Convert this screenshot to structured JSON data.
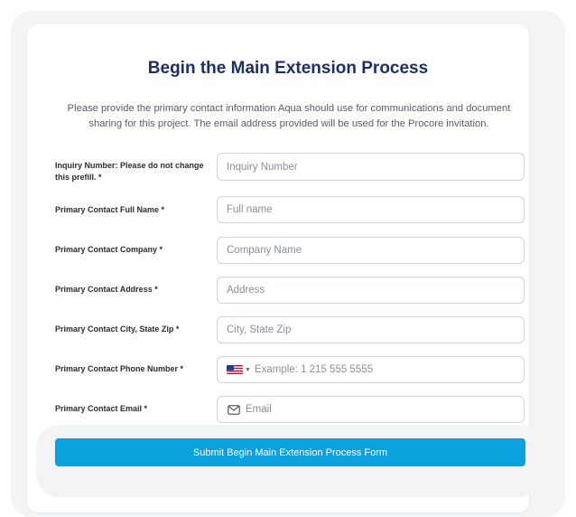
{
  "form": {
    "title": "Begin the Main Extension Process",
    "description": "Please provide the primary contact information Aqua should use for communications and document sharing for this project. The email address provided will be used for the Procore invitation.",
    "fields": [
      {
        "label": "Inquiry Number: Please do not change this prefill. *",
        "placeholder": "Inquiry Number",
        "value": ""
      },
      {
        "label": "Primary Contact Full Name *",
        "placeholder": "Full name",
        "value": ""
      },
      {
        "label": "Primary Contact Company *",
        "placeholder": "Company Name",
        "value": ""
      },
      {
        "label": "Primary Contact Address *",
        "placeholder": "Address",
        "value": ""
      },
      {
        "label": "Primary Contact City, State Zip *",
        "placeholder": "City, State Zip",
        "value": ""
      },
      {
        "label": "Primary Contact Phone Number *",
        "placeholder": "Example: 1 215 555 5555",
        "value": "",
        "country_flag_icon": "us-flag-icon"
      },
      {
        "label": "Primary Contact Email *",
        "placeholder": "Email",
        "value": "",
        "icon": "mail-icon"
      }
    ],
    "submit_label": "Submit Begin Main Extension Process Form"
  },
  "colors": {
    "title": "#1d2e6b",
    "button": "#0aa1dc",
    "outer_background": "#f3f4f6",
    "field_border": "#cfd3da"
  }
}
